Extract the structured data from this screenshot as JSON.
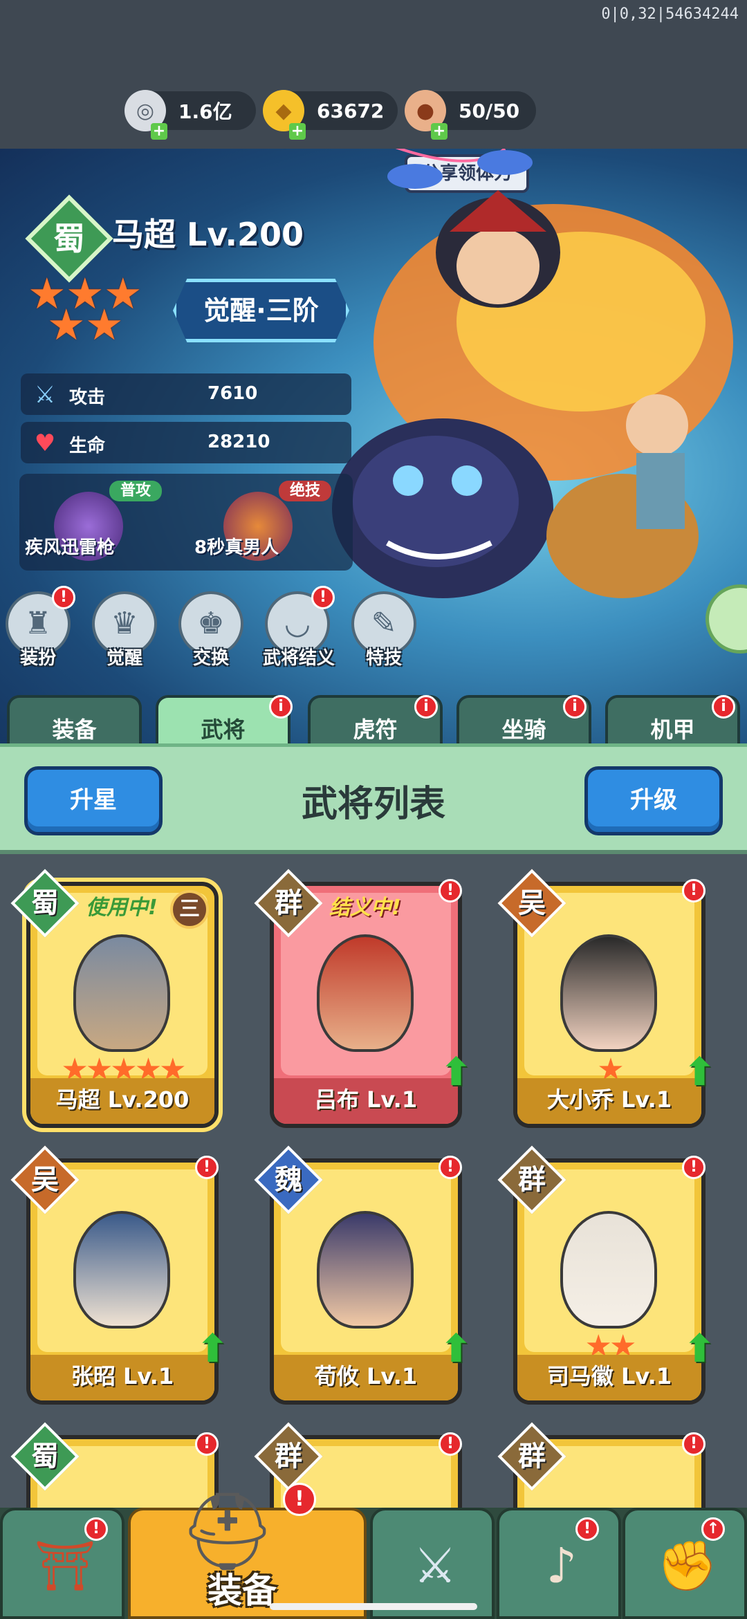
{
  "debug_text": "0|0,32|54634244",
  "resources": [
    {
      "name": "silver",
      "icon": "coin-icon",
      "value": "1.6亿"
    },
    {
      "name": "gold",
      "icon": "ingot-icon",
      "value": "63672"
    },
    {
      "name": "stamina",
      "icon": "meat-icon",
      "value": "50/50"
    }
  ],
  "share_label": "分享领体力",
  "hero": {
    "faction": "蜀",
    "name": "马超 Lv.200",
    "stars": 5,
    "awaken": "觉醒·三阶",
    "stats": [
      {
        "icon": "sword-icon",
        "label": "攻击",
        "value": "7610"
      },
      {
        "icon": "heart-icon",
        "label": "生命",
        "value": "28210"
      }
    ],
    "skills": [
      {
        "tag": "普攻",
        "name": "疾风迅雷枪"
      },
      {
        "tag": "绝技",
        "name": "8秒真男人"
      }
    ]
  },
  "actions": [
    {
      "label": "装扮",
      "badge": "!"
    },
    {
      "label": "觉醒",
      "badge": ""
    },
    {
      "label": "交换",
      "badge": ""
    },
    {
      "label": "武将结义",
      "badge": "!"
    },
    {
      "label": "特技",
      "badge": ""
    }
  ],
  "tabs": [
    {
      "label": "装备",
      "badge": ""
    },
    {
      "label": "武将",
      "badge": "i"
    },
    {
      "label": "虎符",
      "badge": "i"
    },
    {
      "label": "坐骑",
      "badge": "i"
    },
    {
      "label": "机甲",
      "badge": "i"
    }
  ],
  "list_header": {
    "title": "武将列表",
    "left_button": "升星",
    "right_button": "升级"
  },
  "cards": [
    {
      "faction": "蜀",
      "name": "马超 Lv.200",
      "status": "使用中!",
      "rank": "三",
      "stars": "★★★★★"
    },
    {
      "faction": "群",
      "name": "吕布 Lv.1",
      "status": "结义中!",
      "rank": "",
      "stars": ""
    },
    {
      "faction": "吴",
      "name": "大小乔 Lv.1",
      "status": "",
      "rank": "",
      "stars": "★"
    },
    {
      "faction": "吴",
      "name": "张昭 Lv.1",
      "status": "",
      "rank": "",
      "stars": ""
    },
    {
      "faction": "魏",
      "name": "荀攸 Lv.1",
      "status": "",
      "rank": "",
      "stars": ""
    },
    {
      "faction": "群",
      "name": "司马徽 Lv.1",
      "status": "",
      "rank": "",
      "stars": "★★"
    },
    {
      "faction": "蜀",
      "name": "",
      "status": "",
      "rank": "",
      "stars": ""
    },
    {
      "faction": "群",
      "name": "",
      "status": "",
      "rank": "",
      "stars": ""
    },
    {
      "faction": "群",
      "name": "",
      "status": "",
      "rank": "",
      "stars": ""
    }
  ],
  "bottom_nav": {
    "active_label": "装备",
    "items": [
      "gate-icon",
      "helmet-icon",
      "crossed-swords-icon",
      "horn-icon",
      "fist-icon"
    ]
  },
  "colors": {
    "shu": "#3e9a55",
    "qun": "#8a6a3a",
    "wu": "#c76a2a",
    "wei": "#3a6ac0"
  }
}
